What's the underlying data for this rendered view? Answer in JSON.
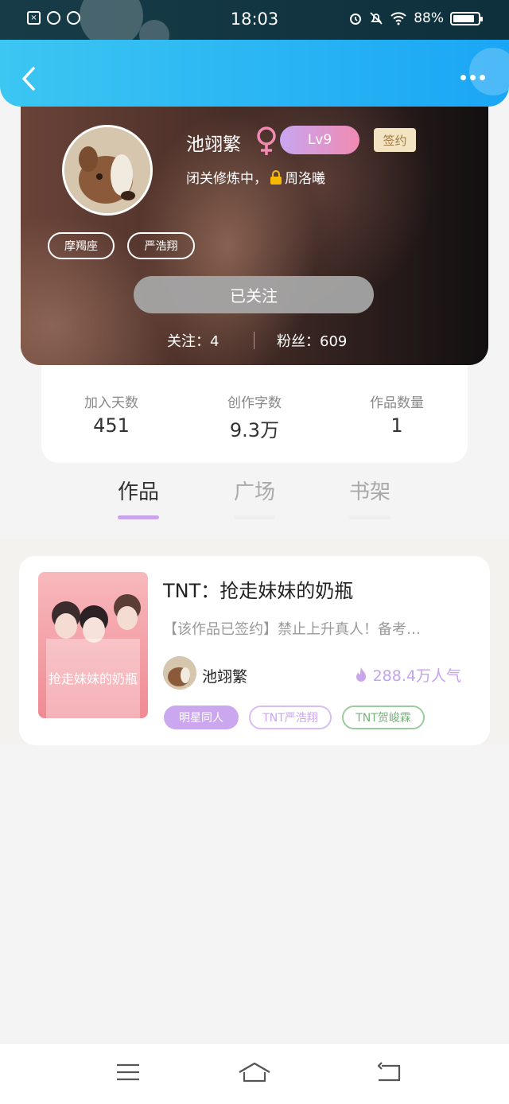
{
  "status_bar": {
    "time": "18:03",
    "battery_text": "88%",
    "battery_level": 0.88,
    "left_icons": [
      "sim-x-icon",
      "wechat-icon",
      "weibo-icon"
    ],
    "right_icons": [
      "alarm-icon",
      "mute-bell-icon",
      "wifi-icon",
      "battery-icon"
    ]
  },
  "header": {
    "back_icon": "chevron-left-icon",
    "more_icon": "more-dots-icon",
    "accent_color": "#1aa6f5"
  },
  "profile": {
    "name": "池翊繁",
    "gender_icon": "female-icon",
    "level": "Lv9",
    "sign_badge": "签约",
    "motto_prefix": "闭关修炼中，",
    "motto_suffix": "周洛曦",
    "tags": [
      "摩羯座",
      "严浩翔"
    ],
    "follow_button": "已关注",
    "following": "关注：4",
    "fans": "粉丝：609"
  },
  "stats": [
    {
      "label": "加入天数",
      "value": "451"
    },
    {
      "label": "创作字数",
      "value": "9.3万"
    },
    {
      "label": "作品数量",
      "value": "1"
    }
  ],
  "tabs": [
    {
      "label": "作品",
      "active": true
    },
    {
      "label": "广场",
      "active": false
    },
    {
      "label": "书架",
      "active": false
    }
  ],
  "work": {
    "title": "TNT：抢走妹妹的奶瓶",
    "description": "【该作品已签约】禁止上升真人！备考…",
    "author": "池翊繁",
    "popularity": "288.4万人气",
    "cover_text": "抢走妹妹的奶瓶",
    "genres": [
      "明星同人",
      "TNT严浩翔",
      "TNT贺峻霖"
    ]
  },
  "nav_bar": {
    "icons": [
      "menu-icon",
      "home-icon",
      "back-icon"
    ]
  }
}
